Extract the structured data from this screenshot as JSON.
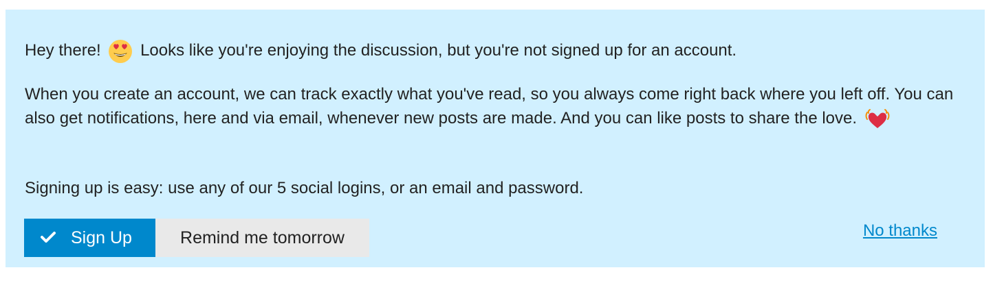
{
  "colors": {
    "banner_background": "#d1f0ff",
    "primary": "#0088cc",
    "secondary_button": "#e9e9e9",
    "text": "#222222"
  },
  "message": {
    "line1_before": "Hey there!",
    "line1_emoji": "heart-eyes-emoji",
    "line1_after": "Looks like you're enjoying the discussion, but you're not signed up for an account.",
    "line2": "When you create an account, we can track exactly what you've read, so you always come right back where you left off. You can also get notifications, here and via email, whenever new posts are made. And you can like posts to share the love.",
    "line2_emoji": "beating-heart-emoji",
    "line3": "Signing up is easy: use any of our 5 social logins, or an email and password."
  },
  "actions": {
    "signup_label": "Sign Up",
    "signup_icon": "check-icon",
    "remind_label": "Remind me tomorrow",
    "dismiss_label": "No thanks"
  }
}
